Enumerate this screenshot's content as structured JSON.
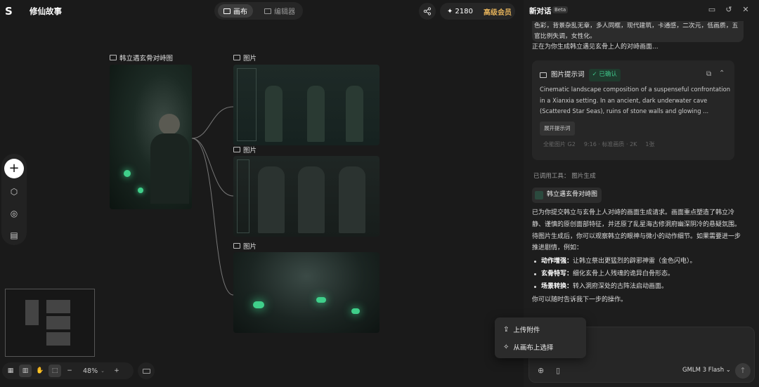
{
  "header": {
    "logo": "S",
    "project_title": "修仙故事",
    "tab_canvas": "画布",
    "tab_editor": "编辑器",
    "credits": "✦ 2180",
    "vip": "高级会员"
  },
  "canvas": {
    "nodes": [
      {
        "caption": "韩立遇玄骨对峙图"
      },
      {
        "caption": "图片"
      },
      {
        "caption": "图片"
      },
      {
        "caption": "图片"
      }
    ]
  },
  "toolbar": {
    "zoom": "48%"
  },
  "panel": {
    "title": "新对话",
    "beta": "Beta",
    "user_message": "色彩，背景杂乱无章，多人同框，现代建筑，卡通感，二次元，低画质，五官比例失调，女性化。",
    "status": "正在为你生成韩立遇见玄骨上人的对峙画面...",
    "prompt_card": {
      "title": "图片提示词",
      "confirmed": "✓ 已确认",
      "text": "Cinematic landscape composition of a suspenseful confrontation in a Xianxia setting. In an ancient, dark underwater cave (Scattered Star Seas), ruins of stone walls and glowing ...",
      "expand": "展开提示词",
      "model": "全能图片 G2",
      "ratio": "9:16 · 标准画质 · 2K",
      "count": "1张"
    },
    "tool_used": "已调用工具：  图片生成",
    "result_chip": "韩立遇玄骨对峙图",
    "reply_intro": "已为你提交韩立与玄骨上人对峙的画面生成请求。画面重点塑造了韩立冷静、谨慎的原创面部特征，并还原了乱星海古修洞府幽深阴冷的悬疑氛围。",
    "reply_mid": "待图片生成后，你可以观察韩立的眼神与微小的动作细节。如果需要进一步推进剧情，例如：",
    "bullets": [
      {
        "head": "动作增强：",
        "text": "让韩立祭出更猛烈的辟邪神雷（金色闪电）。"
      },
      {
        "head": "玄骨特写：",
        "text": "细化玄骨上人残魂的诡异白骨形态。"
      },
      {
        "head": "场景转换：",
        "text": "转入洞府深处的古阵法启动画面。"
      }
    ],
    "reply_end": "你可以随时告诉我下一步的操作。",
    "popup": {
      "upload": "上传附件",
      "select": "从画布上选择"
    },
    "model": "GMLM 3 Flash ⌄"
  }
}
